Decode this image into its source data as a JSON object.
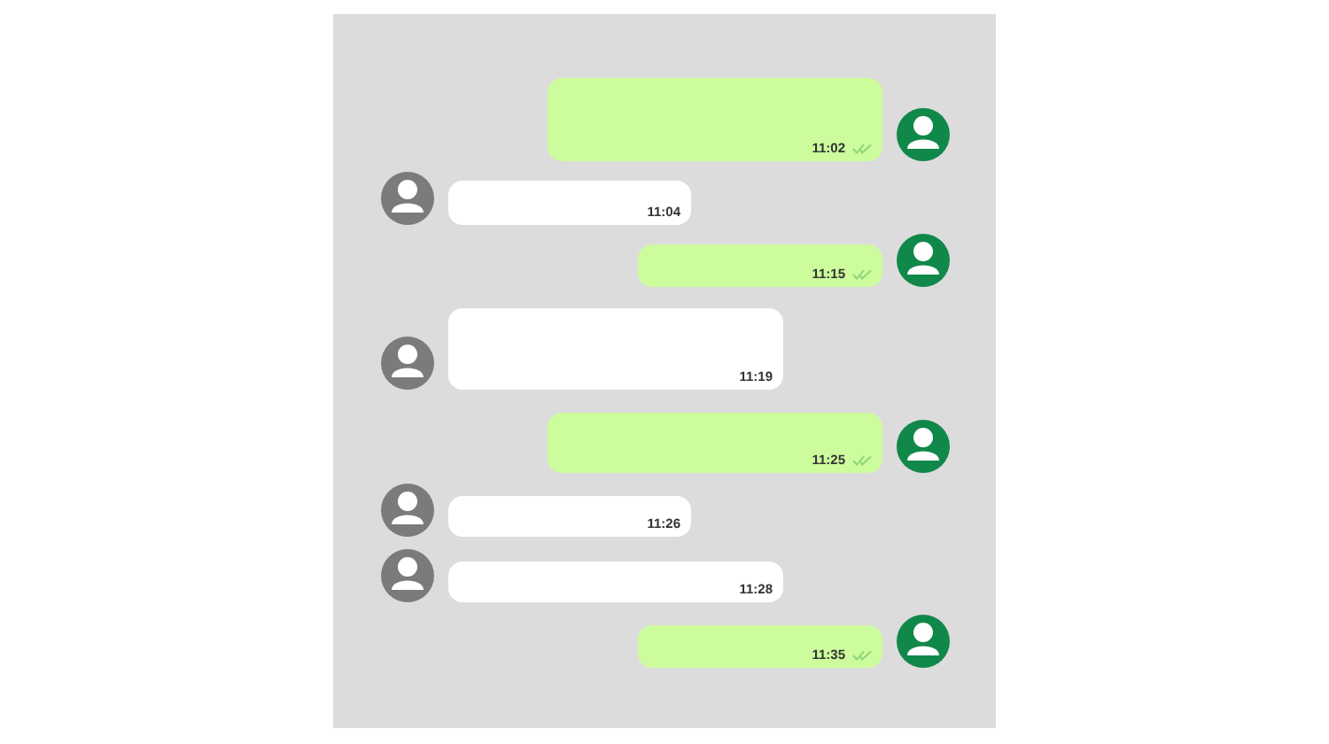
{
  "messages": [
    {
      "kind": "sent",
      "time": "11:02"
    },
    {
      "kind": "received",
      "time": "11:04"
    },
    {
      "kind": "sent",
      "time": "11:15"
    },
    {
      "kind": "received",
      "time": "11:19"
    },
    {
      "kind": "sent",
      "time": "11:25"
    },
    {
      "kind": "received",
      "time": "11:26"
    },
    {
      "kind": "received",
      "time": "11:28"
    },
    {
      "kind": "sent",
      "time": "11:35"
    }
  ]
}
